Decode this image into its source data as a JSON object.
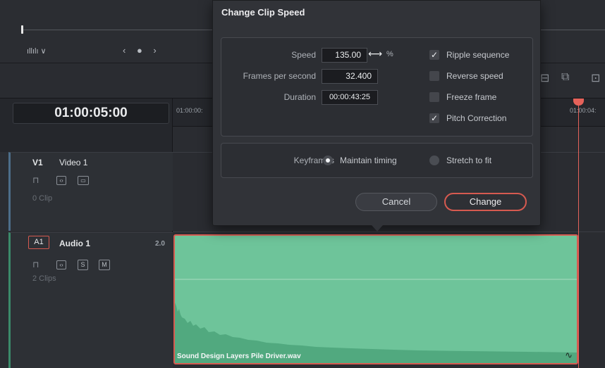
{
  "viewer": {
    "wave_menu": "ıllılı ∨",
    "nav_arrows": "‹ ● ›"
  },
  "timeline": {
    "timecode": "01:00:05:00",
    "ruler_labels": [
      "01:00:00:",
      "01:00:04:"
    ],
    "tracks": {
      "video": {
        "id": "V1",
        "name": "Video 1",
        "clip_count": "0 Clip"
      },
      "audio": {
        "id": "A1",
        "name": "Audio 1",
        "channels": "2.0",
        "clip_count": "2 Clips",
        "solo": "S",
        "mute": "M"
      }
    },
    "audio_clip": {
      "name": "Sound Design Layers Pile Driver.wav"
    }
  },
  "dialog": {
    "title": "Change Clip Speed",
    "speed_label": "Speed",
    "speed_value": "135.00",
    "speed_unit": "%",
    "fps_label": "Frames per second",
    "fps_value": "32.400",
    "duration_label": "Duration",
    "duration_value": "00:00:43:25",
    "options": [
      {
        "label": "Ripple sequence",
        "checked": true
      },
      {
        "label": "Reverse speed",
        "checked": false
      },
      {
        "label": "Freeze frame",
        "checked": false
      },
      {
        "label": "Pitch Correction",
        "checked": true
      }
    ],
    "keyframes_label": "Keyframes",
    "keyframe_options": [
      {
        "label": "Maintain timing",
        "selected": true
      },
      {
        "label": "Stretch to fit",
        "selected": false
      }
    ],
    "cancel_label": "Cancel",
    "change_label": "Change"
  },
  "colors": {
    "accent": "#d65a50",
    "audio_clip": "#6ec49a",
    "playhead": "#e5625a"
  }
}
